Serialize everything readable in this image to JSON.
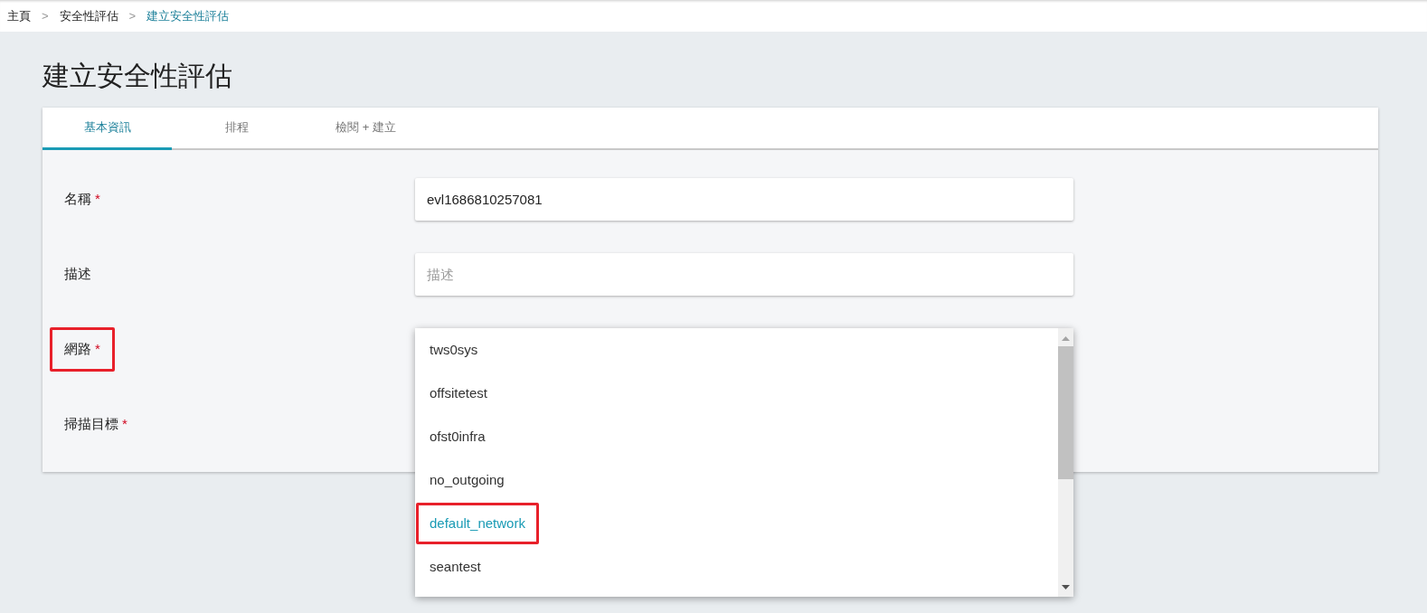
{
  "breadcrumb": [
    {
      "label": "主頁",
      "current": false,
      "separator": ">"
    },
    {
      "label": "安全性評估",
      "current": false,
      "separator": ">"
    },
    {
      "label": "建立安全性評估",
      "current": true
    }
  ],
  "title": "建立安全性評估",
  "tabs": [
    {
      "label": "基本資訊",
      "selected": true
    },
    {
      "label": "排程",
      "selected": false
    },
    {
      "label": "檢閱 + 建立",
      "selected": false
    }
  ],
  "fields": [
    {
      "kind": "text",
      "label": "名稱",
      "required_mark": "*",
      "value": "evl1686810257081",
      "highlighted": false
    },
    {
      "kind": "text",
      "label": "描述",
      "placeholder": "描述",
      "highlighted": false
    },
    {
      "kind": "select",
      "label": "網路",
      "required_mark": "*",
      "highlighted": true,
      "options": [
        {
          "label": "tws0sys",
          "selected": false,
          "highlighted": false
        },
        {
          "label": "offsitetest",
          "selected": false,
          "highlighted": false
        },
        {
          "label": "ofst0infra",
          "selected": false,
          "highlighted": false
        },
        {
          "label": "no_outgoing",
          "selected": false,
          "highlighted": false
        },
        {
          "label": "default_network",
          "selected": true,
          "highlighted": true
        },
        {
          "label": "seantest",
          "selected": false,
          "highlighted": false
        }
      ]
    },
    {
      "kind": "empty",
      "label": "掃描目標",
      "required_mark": "*",
      "highlighted": false
    }
  ]
}
